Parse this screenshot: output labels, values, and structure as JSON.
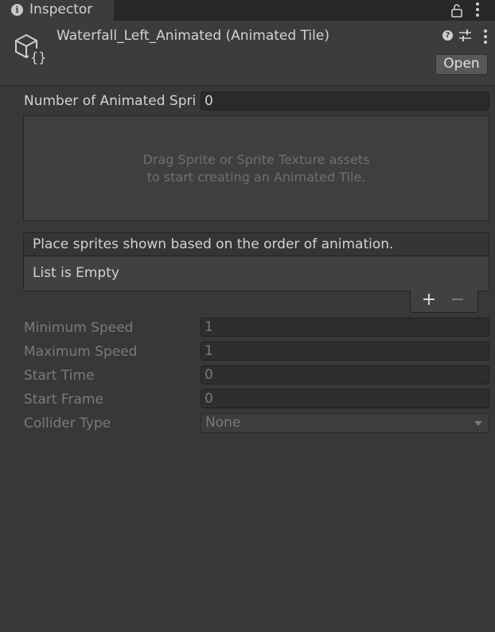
{
  "tab": {
    "icon": "info-icon",
    "label": "Inspector",
    "lock_icon": "lock-icon",
    "menu_icon": "kebab-menu-icon"
  },
  "header": {
    "asset_icon": "animated-tile-script-icon",
    "title": "Waterfall_Left_Animated (Animated Tile)",
    "help_icon": "help-icon",
    "help_glyph": "?",
    "preset_icon": "preset-sliders-icon",
    "menu_icon": "kebab-menu-icon",
    "open_label": "Open"
  },
  "number_of_sprites": {
    "label": "Number of Animated Spri",
    "value": "0"
  },
  "dropzone": {
    "line1": "Drag Sprite or Sprite Texture assets",
    "line2": "to start creating an Animated Tile."
  },
  "sprite_list": {
    "header": "Place sprites shown based on the order of animation.",
    "empty_text": "List is Empty",
    "add_label": "+",
    "remove_label": "−"
  },
  "fields": [
    {
      "label": "Minimum Speed",
      "value": "1"
    },
    {
      "label": "Maximum Speed",
      "value": "1"
    },
    {
      "label": "Start Time",
      "value": "0"
    },
    {
      "label": "Start Frame",
      "value": "0"
    }
  ],
  "collider_type": {
    "label": "Collider Type",
    "value": "None"
  },
  "colors": {
    "background": "#383838",
    "header": "#3c3c3c",
    "tabbar": "#282828",
    "field": "#2a2a2a",
    "text": "#d2d2d2",
    "disabled_text": "#7a7a7a"
  }
}
